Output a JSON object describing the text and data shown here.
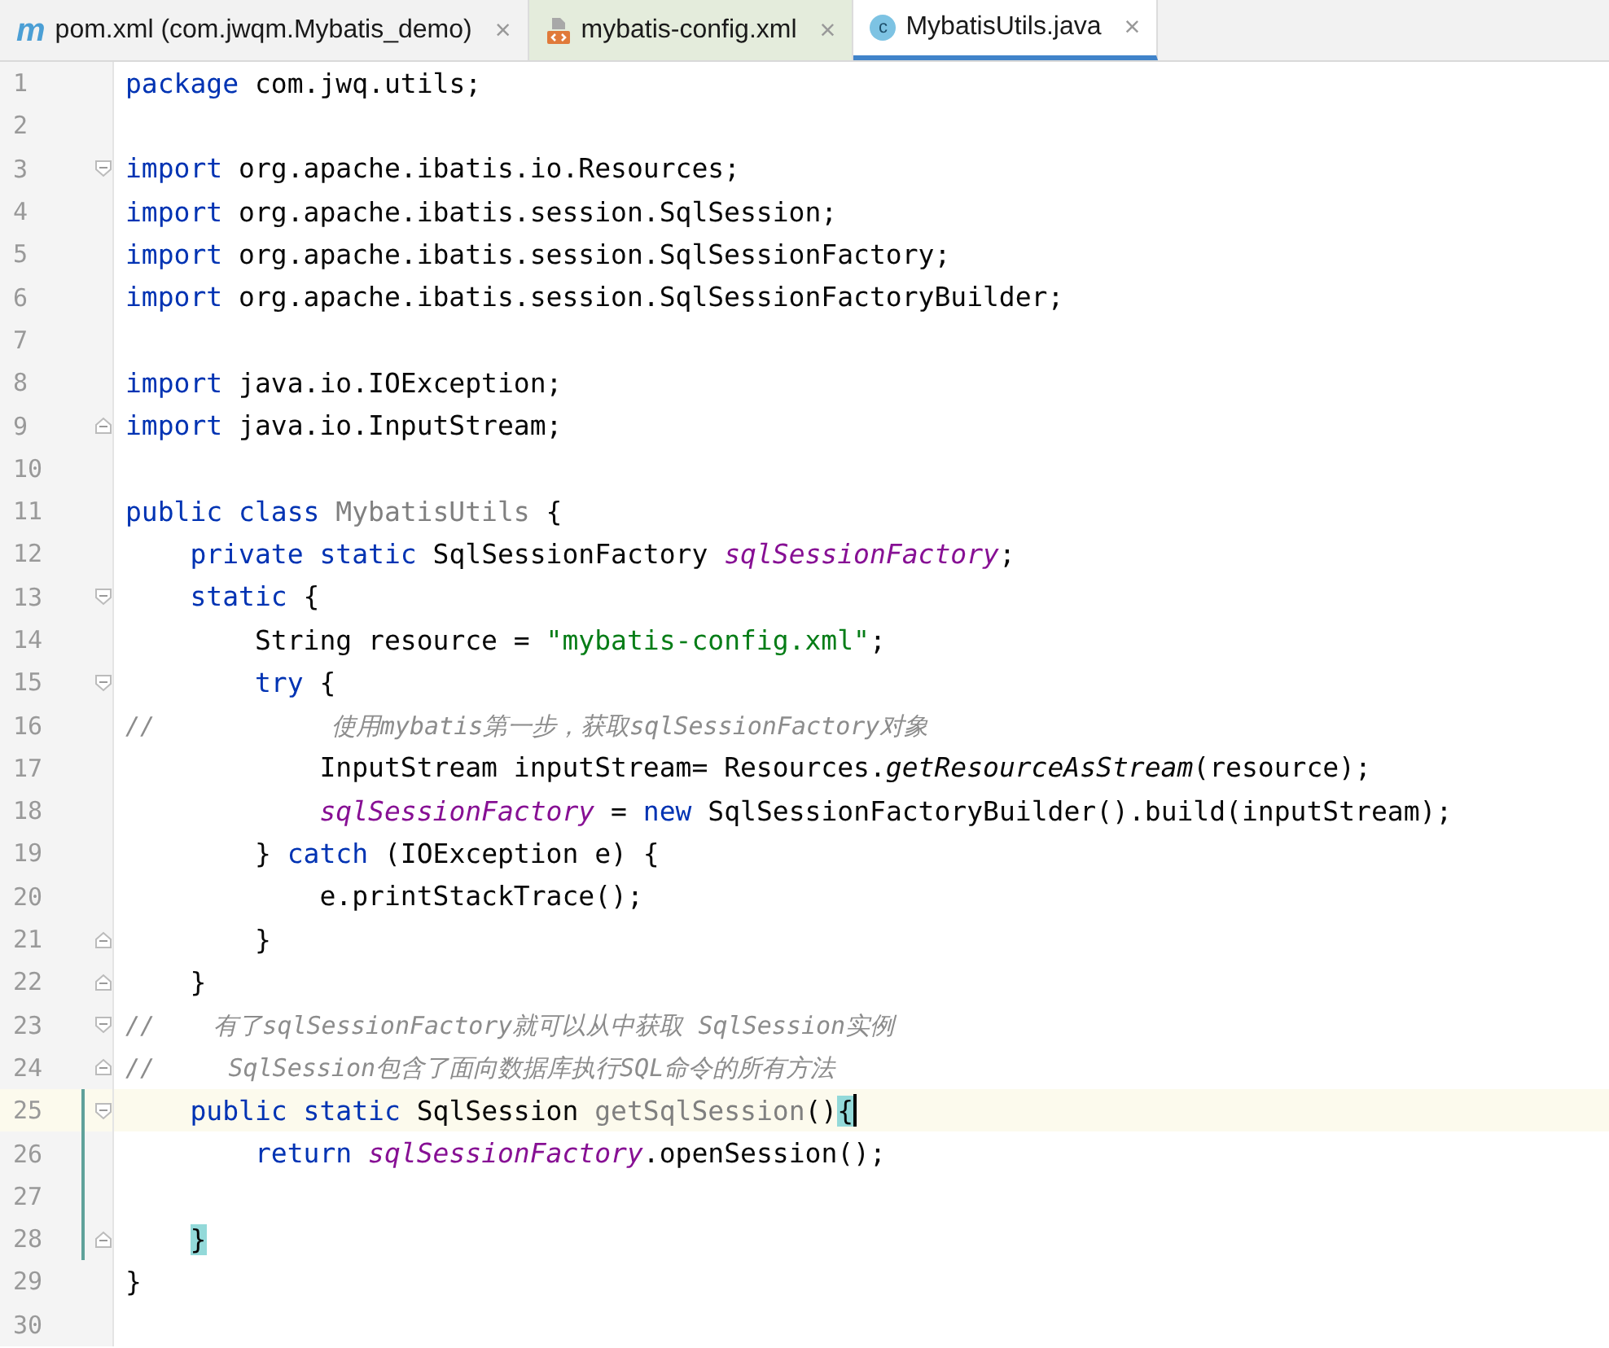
{
  "tabs": [
    {
      "kind": "maven",
      "icon_text": "m",
      "label": "pom.xml (com.jwqm.Mybatis_demo)",
      "close": "×",
      "selected": false
    },
    {
      "kind": "xml",
      "label": "mybatis-config.xml",
      "close": "×",
      "selected": false
    },
    {
      "kind": "class",
      "icon_text": "c",
      "label": "MybatisUtils.java",
      "close": "×",
      "selected": true
    }
  ],
  "lines": [
    {
      "number": "1",
      "tokens": [
        {
          "text": "package",
          "kind": "kw"
        },
        {
          "text": " com.jwq.utils;",
          "kind": "plain"
        }
      ]
    },
    {
      "number": "2"
    },
    {
      "number": "3",
      "fold_start": true,
      "tokens": [
        {
          "text": "import",
          "kind": "kw"
        },
        {
          "text": " org.apache.ibatis.io.Resources;",
          "kind": "plain"
        }
      ]
    },
    {
      "number": "4",
      "tokens": [
        {
          "text": "import",
          "kind": "kw"
        },
        {
          "text": " org.apache.ibatis.session.SqlSession;",
          "kind": "plain"
        }
      ]
    },
    {
      "number": "5",
      "tokens": [
        {
          "text": "import",
          "kind": "kw"
        },
        {
          "text": " org.apache.ibatis.session.SqlSessionFactory;",
          "kind": "plain"
        }
      ]
    },
    {
      "number": "6",
      "tokens": [
        {
          "text": "import",
          "kind": "kw"
        },
        {
          "text": " org.apache.ibatis.session.SqlSessionFactoryBuilder;",
          "kind": "plain"
        }
      ]
    },
    {
      "number": "7"
    },
    {
      "number": "8",
      "tokens": [
        {
          "text": "import",
          "kind": "kw"
        },
        {
          "text": " java.io.IOException;",
          "kind": "plain"
        }
      ]
    },
    {
      "number": "9",
      "fold_end": true,
      "tokens": [
        {
          "text": "import",
          "kind": "kw"
        },
        {
          "text": " java.io.InputStream;",
          "kind": "plain"
        }
      ]
    },
    {
      "number": "10"
    },
    {
      "number": "11",
      "tokens": [
        {
          "text": "public class ",
          "kind": "kw"
        },
        {
          "text": "MybatisUtils",
          "kind": "unused"
        },
        {
          "text": " {",
          "kind": "plain"
        }
      ]
    },
    {
      "number": "12",
      "tokens": [
        {
          "text": "    private static",
          "kind": "kw"
        },
        {
          "text": " SqlSessionFactory ",
          "kind": "plain"
        },
        {
          "text": "sqlSessionFactory",
          "kind": "field"
        },
        {
          "text": ";",
          "kind": "plain"
        }
      ]
    },
    {
      "number": "13",
      "fold_start": true,
      "tokens": [
        {
          "text": "    static",
          "kind": "kw"
        },
        {
          "text": " {",
          "kind": "plain"
        }
      ]
    },
    {
      "number": "14",
      "tokens": [
        {
          "text": "        String resource = ",
          "kind": "plain"
        },
        {
          "text": "\"mybatis-config.xml\"",
          "kind": "str"
        },
        {
          "text": ";",
          "kind": "plain"
        }
      ]
    },
    {
      "number": "15",
      "fold_start": true,
      "tokens": [
        {
          "text": "        try",
          "kind": "kw"
        },
        {
          "text": " {",
          "kind": "plain"
        }
      ]
    },
    {
      "number": "16",
      "tokens": [
        {
          "text": "//            使用mybatis第一步，获取sqlSessionFactory对象",
          "kind": "comment"
        }
      ]
    },
    {
      "number": "17",
      "tokens": [
        {
          "text": "            InputStream inputStream= Resources.",
          "kind": "plain"
        },
        {
          "text": "getResourceAsStream",
          "kind": "static"
        },
        {
          "text": "(resource);",
          "kind": "plain"
        }
      ]
    },
    {
      "number": "18",
      "tokens": [
        {
          "text": "            sqlSessionFactory",
          "kind": "field"
        },
        {
          "text": " = ",
          "kind": "plain"
        },
        {
          "text": "new",
          "kind": "kw"
        },
        {
          "text": " SqlSessionFactoryBuilder().build(inputStream);",
          "kind": "plain"
        }
      ]
    },
    {
      "number": "19",
      "tokens": [
        {
          "text": "        } ",
          "kind": "plain"
        },
        {
          "text": "catch",
          "kind": "kw"
        },
        {
          "text": " (IOException e) {",
          "kind": "plain"
        }
      ]
    },
    {
      "number": "20",
      "tokens": [
        {
          "text": "            e.printStackTrace();",
          "kind": "plain"
        }
      ]
    },
    {
      "number": "21",
      "fold_end": true,
      "tokens": [
        {
          "text": "        }",
          "kind": "plain"
        }
      ]
    },
    {
      "number": "22",
      "fold_end": true,
      "tokens": [
        {
          "text": "    }",
          "kind": "plain"
        }
      ]
    },
    {
      "number": "23",
      "fold_start": true,
      "tokens": [
        {
          "text": "//    有了sqlSessionFactory就可以从中获取 SqlSession实例",
          "kind": "comment"
        }
      ]
    },
    {
      "number": "24",
      "fold_end": true,
      "tokens": [
        {
          "text": "//     SqlSession包含了面向数据库执行SQL命令的所有方法",
          "kind": "comment"
        }
      ]
    },
    {
      "number": "25",
      "fold_start": true,
      "current": true,
      "changed": true,
      "tokens": [
        {
          "text": "    public static",
          "kind": "kw"
        },
        {
          "text": " SqlSession ",
          "kind": "plain"
        },
        {
          "text": "getSqlSession",
          "kind": "unused"
        },
        {
          "text": "()",
          "kind": "plain"
        },
        {
          "text": "{",
          "kind": "match"
        }
      ]
    },
    {
      "number": "26",
      "changed": true,
      "tokens": [
        {
          "text": "        return ",
          "kind": "kw"
        },
        {
          "text": "sqlSessionFactory",
          "kind": "field"
        },
        {
          "text": ".openSession();",
          "kind": "plain"
        }
      ]
    },
    {
      "number": "27",
      "changed": true
    },
    {
      "number": "28",
      "fold_end": true,
      "changed": true,
      "tokens": [
        {
          "text": "    }",
          "kind": "match"
        }
      ]
    },
    {
      "number": "29",
      "tokens": [
        {
          "text": "}",
          "kind": "plain"
        }
      ]
    },
    {
      "number": "30"
    }
  ]
}
